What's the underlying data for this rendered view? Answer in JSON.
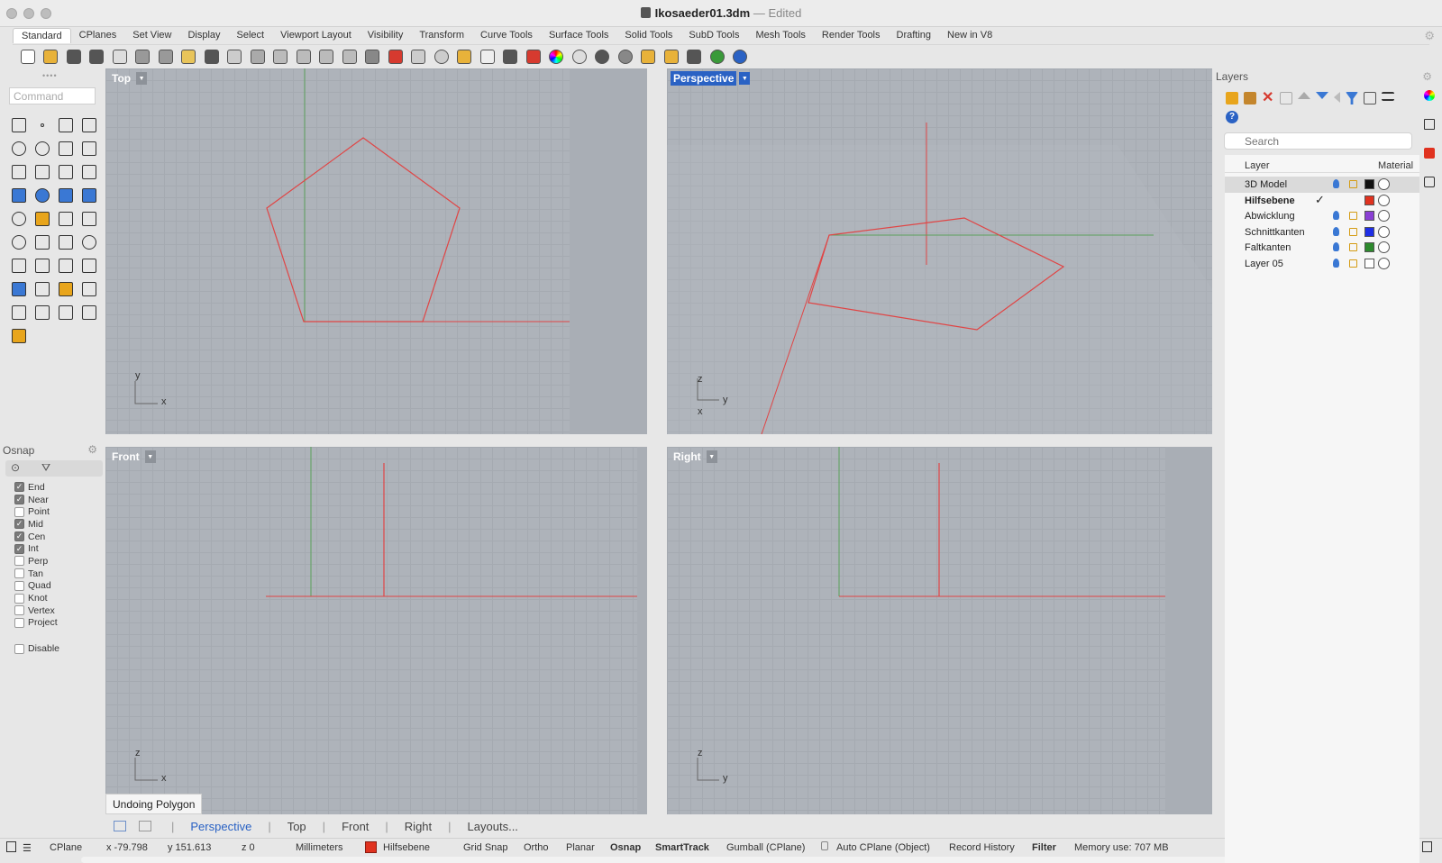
{
  "window": {
    "title": "Ikosaeder01.3dm",
    "edited": "Edited"
  },
  "tabs": [
    "Standard",
    "CPlanes",
    "Set View",
    "Display",
    "Select",
    "Viewport Layout",
    "Visibility",
    "Transform",
    "Curve Tools",
    "Surface Tools",
    "Solid Tools",
    "SubD Tools",
    "Mesh Tools",
    "Render Tools",
    "Drafting",
    "New in V8"
  ],
  "active_tab": "Standard",
  "toolbar_icons": [
    "new-icon",
    "open-icon",
    "save-icon",
    "print-icon",
    "import-icon",
    "cut-icon",
    "copy-icon",
    "paste-icon",
    "undo-icon",
    "pan-hand-icon",
    "rotate-view-icon",
    "zoom-icon",
    "zoom-window-icon",
    "zoom-extents-icon",
    "zoom-selected-icon",
    "four-viewports-icon",
    "car-icon",
    "grid-plane-icon",
    "circle-icon",
    "select-points-icon",
    "bulb-icon",
    "lock-icon",
    "layer-icon",
    "color-wheel-icon",
    "sphere-wire-icon",
    "sphere-shaded-icon",
    "sphere-rendered-icon",
    "flag-icon",
    "gear-render-icon",
    "dimension-icon",
    "globe-icon",
    "help-icon"
  ],
  "command": {
    "placeholder": "Command"
  },
  "tools_left": [
    "select-arrow-icon",
    "point-icon",
    "curve-icon",
    "polyline-icon",
    "circle-icon",
    "ellipse-icon",
    "arc-icon",
    "rectangle-icon",
    "polygon-icon",
    "fillet-curve-icon",
    "surface-icon",
    "revolve-icon",
    "box-icon",
    "sphere-icon",
    "cylinder-icon",
    "extrude-icon",
    "points-on-icon",
    "explode-icon",
    "trim-icon",
    "split-icon",
    "group-icon",
    "boolean-icon",
    "offset-icon",
    "blend-icon",
    "text-icon",
    "dimension-icon",
    "array-icon",
    "transform-icon",
    "solid-box-icon",
    "grid-array-icon",
    "match-icon",
    "pipe-icon",
    "fold-icon",
    "curve-tools-icon",
    "check-icon",
    "analyze-icon",
    "light-icon"
  ],
  "osnap": {
    "title": "Osnap",
    "items": [
      {
        "label": "End",
        "checked": true
      },
      {
        "label": "Near",
        "checked": true
      },
      {
        "label": "Point",
        "checked": false
      },
      {
        "label": "Mid",
        "checked": true
      },
      {
        "label": "Cen",
        "checked": true
      },
      {
        "label": "Int",
        "checked": true
      },
      {
        "label": "Perp",
        "checked": false
      },
      {
        "label": "Tan",
        "checked": false
      },
      {
        "label": "Quad",
        "checked": false
      },
      {
        "label": "Knot",
        "checked": false
      },
      {
        "label": "Vertex",
        "checked": false
      },
      {
        "label": "Project",
        "checked": false
      }
    ],
    "disable": {
      "label": "Disable",
      "checked": false
    }
  },
  "viewports": {
    "top": {
      "label": "Top",
      "axis1": "y",
      "axis2": "x"
    },
    "perspective": {
      "label": "Perspective",
      "axis1": "z",
      "axis2": "y",
      "axis3": "x"
    },
    "front": {
      "label": "Front",
      "axis1": "z",
      "axis2": "x"
    },
    "right": {
      "label": "Right",
      "axis1": "z",
      "axis2": "y"
    }
  },
  "tooltip": "Undoing Polygon",
  "viewport_tabs": {
    "items": [
      "Perspective",
      "Top",
      "Front",
      "Right"
    ],
    "active": "Perspective",
    "layouts": "Layouts..."
  },
  "status": {
    "cplane": "CPlane",
    "x": "x -79.798",
    "y": "y 151.613",
    "z": "z 0",
    "units": "Millimeters",
    "layer": "Hilfsebene",
    "grid_snap": "Grid Snap",
    "ortho": "Ortho",
    "planar": "Planar",
    "osnap": "Osnap",
    "smarttrack": "SmartTrack",
    "gumball": "Gumball (CPlane)",
    "autocplane": "Auto CPlane (Object)",
    "record_history": "Record History",
    "filter": "Filter",
    "memory": "Memory use: 707 MB"
  },
  "layers": {
    "title": "Layers",
    "search_placeholder": "Search",
    "col_layer": "Layer",
    "col_material": "Material",
    "rows": [
      {
        "name": "3D Model",
        "color": "#111111",
        "current": false,
        "selected": true,
        "visible": true
      },
      {
        "name": "Hilfsebene",
        "color": "#e0321f",
        "current": true,
        "selected": false,
        "visible": false
      },
      {
        "name": "Abwicklung",
        "color": "#8a3fd4",
        "current": false,
        "selected": false,
        "visible": true
      },
      {
        "name": "Schnittkanten",
        "color": "#1f2fe6",
        "current": false,
        "selected": false,
        "visible": true
      },
      {
        "name": "Faltkanten",
        "color": "#2d8a2d",
        "current": false,
        "selected": false,
        "visible": true
      },
      {
        "name": "Layer 05",
        "color": "#ffffff",
        "current": false,
        "selected": false,
        "visible": true
      }
    ]
  },
  "colors": {
    "curve": "#e04545",
    "grid_green": "#5aa05a",
    "accent": "#2a62c4"
  }
}
